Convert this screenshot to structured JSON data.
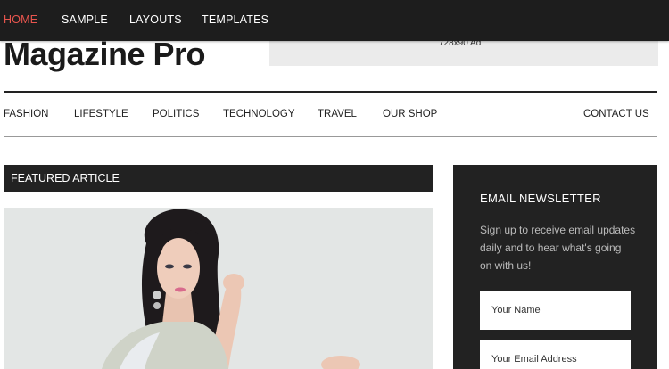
{
  "topnav": {
    "items": [
      "HOME",
      "SAMPLE",
      "LAYOUTS",
      "TEMPLATES"
    ],
    "active_color": "#e8554e"
  },
  "header": {
    "title": "Magazine Pro",
    "ad_label": "728x90 Ad"
  },
  "mainnav": {
    "items": [
      "FASHION",
      "LIFESTYLE",
      "POLITICS",
      "TECHNOLOGY",
      "TRAVEL",
      "OUR SHOP"
    ],
    "contact": "CONTACT US"
  },
  "featured": {
    "heading": "FEATURED ARTICLE"
  },
  "newsletter": {
    "heading": "EMAIL NEWSLETTER",
    "description": "Sign up to receive email updates daily and to hear what's going on with us!",
    "name_placeholder": "Your Name",
    "email_placeholder": "Your Email Address"
  }
}
